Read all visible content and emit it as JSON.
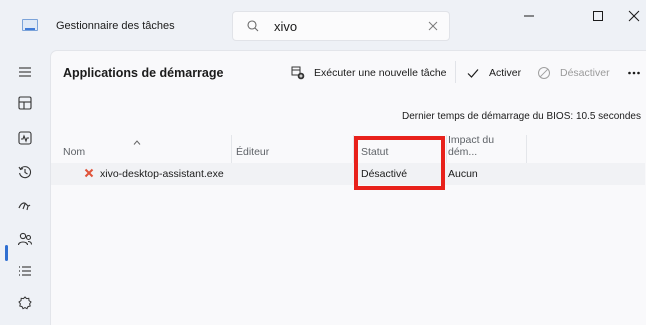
{
  "window": {
    "title": "Gestionnaire des tâches",
    "search": {
      "value": "xivo"
    }
  },
  "sidebar": {
    "items": [
      {
        "name": "menu",
        "icon": "hamburger-menu-icon"
      },
      {
        "name": "processus",
        "icon": "processes-icon"
      },
      {
        "name": "performances",
        "icon": "performance-icon"
      },
      {
        "name": "historique",
        "icon": "history-icon"
      },
      {
        "name": "demarrage",
        "icon": "startup-apps-icon",
        "active": true
      },
      {
        "name": "utilisateurs",
        "icon": "users-icon"
      },
      {
        "name": "details",
        "icon": "details-icon"
      },
      {
        "name": "services",
        "icon": "services-icon"
      }
    ]
  },
  "main": {
    "title": "Applications de démarrage",
    "toolbar": {
      "run_task": "Exécuter une nouvelle tâche",
      "enable": "Activer",
      "disable": "Désactiver"
    },
    "bios_time": "Dernier temps de démarrage du BIOS: 10.5 secondes",
    "columns": {
      "name": "Nom",
      "publisher": "Éditeur",
      "status": "Statut",
      "impact": "Impact du dém..."
    },
    "rows": [
      {
        "name": "xivo-desktop-assistant.exe",
        "publisher": "",
        "status": "Désactivé",
        "impact": "Aucun"
      }
    ]
  },
  "colors": {
    "accent": "#2f6fd1",
    "highlight": "#e8211b",
    "row_icon": "#e0533a"
  }
}
